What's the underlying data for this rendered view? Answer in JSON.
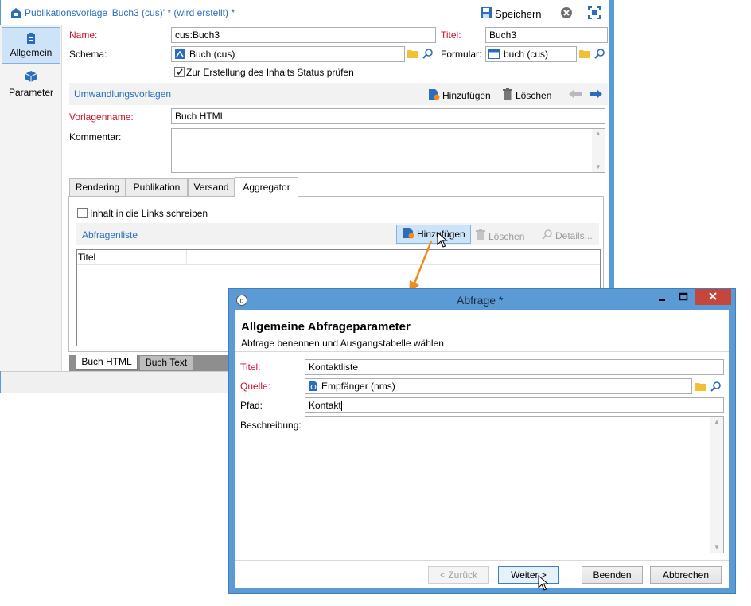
{
  "main": {
    "title": "Publikationsvorlage 'Buch3 (cus)' * (wird erstellt) *",
    "save_label": "Speichern",
    "sidebar": [
      {
        "label": "Allgemein"
      },
      {
        "label": "Parameter"
      }
    ],
    "name_label": "Name:",
    "name_value": "cus:Buch3",
    "titel_label": "Titel:",
    "titel_value": "Buch3",
    "schema_label": "Schema:",
    "schema_value": "Buch (cus)",
    "formular_label": "Formular:",
    "formular_value": "buch (cus)",
    "status_checkbox": "Zur Erstellung des Inhalts Status prüfen",
    "templates_section": "Umwandlungsvorlagen",
    "add_label": "Hinzufügen",
    "delete_label": "Löschen",
    "vorlagenname_label": "Vorlagenname:",
    "vorlagenname_value": "Buch HTML",
    "kommentar_label": "Kommentar:",
    "tabs": [
      "Rendering",
      "Publikation",
      "Versand",
      "Aggregator"
    ],
    "links_checkbox": "Inhalt in die Links schreiben",
    "queries_section": "Abfragenliste",
    "details_label": "Details...",
    "column_titel": "Titel",
    "bottom_tabs": [
      "Buch HTML",
      "Buch Text"
    ]
  },
  "dialog": {
    "title": "Abfrage *",
    "heading": "Allgemeine Abfrageparameter",
    "subheading": "Abfrage benennen und Ausgangstabelle wählen",
    "titel_label": "Titel:",
    "titel_value": "Kontaktliste",
    "quelle_label": "Quelle:",
    "quelle_value": "Empfänger (nms)",
    "pfad_label": "Pfad:",
    "pfad_value": "Kontakt",
    "beschreibung_label": "Beschreibung:",
    "back_label": "< Zurück",
    "next_label": "Weiter >",
    "finish_label": "Beenden",
    "cancel_label": "Abbrechen"
  },
  "colors": {
    "accent": "#2a6ebb",
    "required": "#c8102e",
    "dialog_border": "#5a9ad5",
    "arrow": "#f08c1e"
  }
}
